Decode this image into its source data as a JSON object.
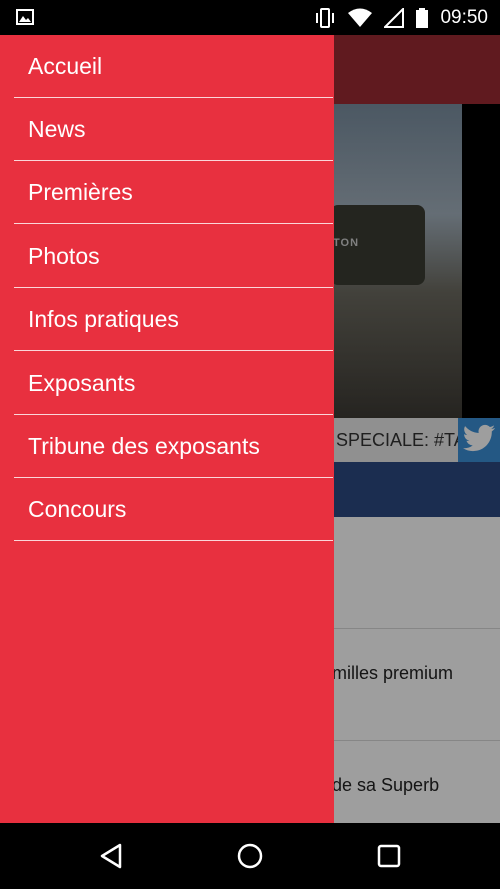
{
  "status_bar": {
    "time": "09:50"
  },
  "background_content": {
    "car_badge": "TON",
    "ticker_text": "SPECIALE: #TA",
    "news_lines": [
      "milles premium",
      "de sa Superb"
    ]
  },
  "drawer": {
    "items": [
      {
        "label": "Accueil"
      },
      {
        "label": "News"
      },
      {
        "label": "Premières"
      },
      {
        "label": "Photos"
      },
      {
        "label": "Infos pratiques"
      },
      {
        "label": "Exposants"
      },
      {
        "label": "Tribune des exposants"
      },
      {
        "label": "Concours"
      }
    ]
  },
  "colors": {
    "drawer_bg": "#e8303f",
    "divider": "#fbd6d9",
    "twitter": "#3a8fd6",
    "blue_bar": "#2c4a82"
  },
  "icons": {
    "status_left": "image-notification-icon",
    "vibrate": "vibrate-icon",
    "wifi": "wifi-icon",
    "signal": "signal-icon",
    "battery": "battery-icon",
    "twitter": "twitter-icon",
    "back": "back-icon",
    "home": "home-icon",
    "recents": "recents-icon"
  }
}
